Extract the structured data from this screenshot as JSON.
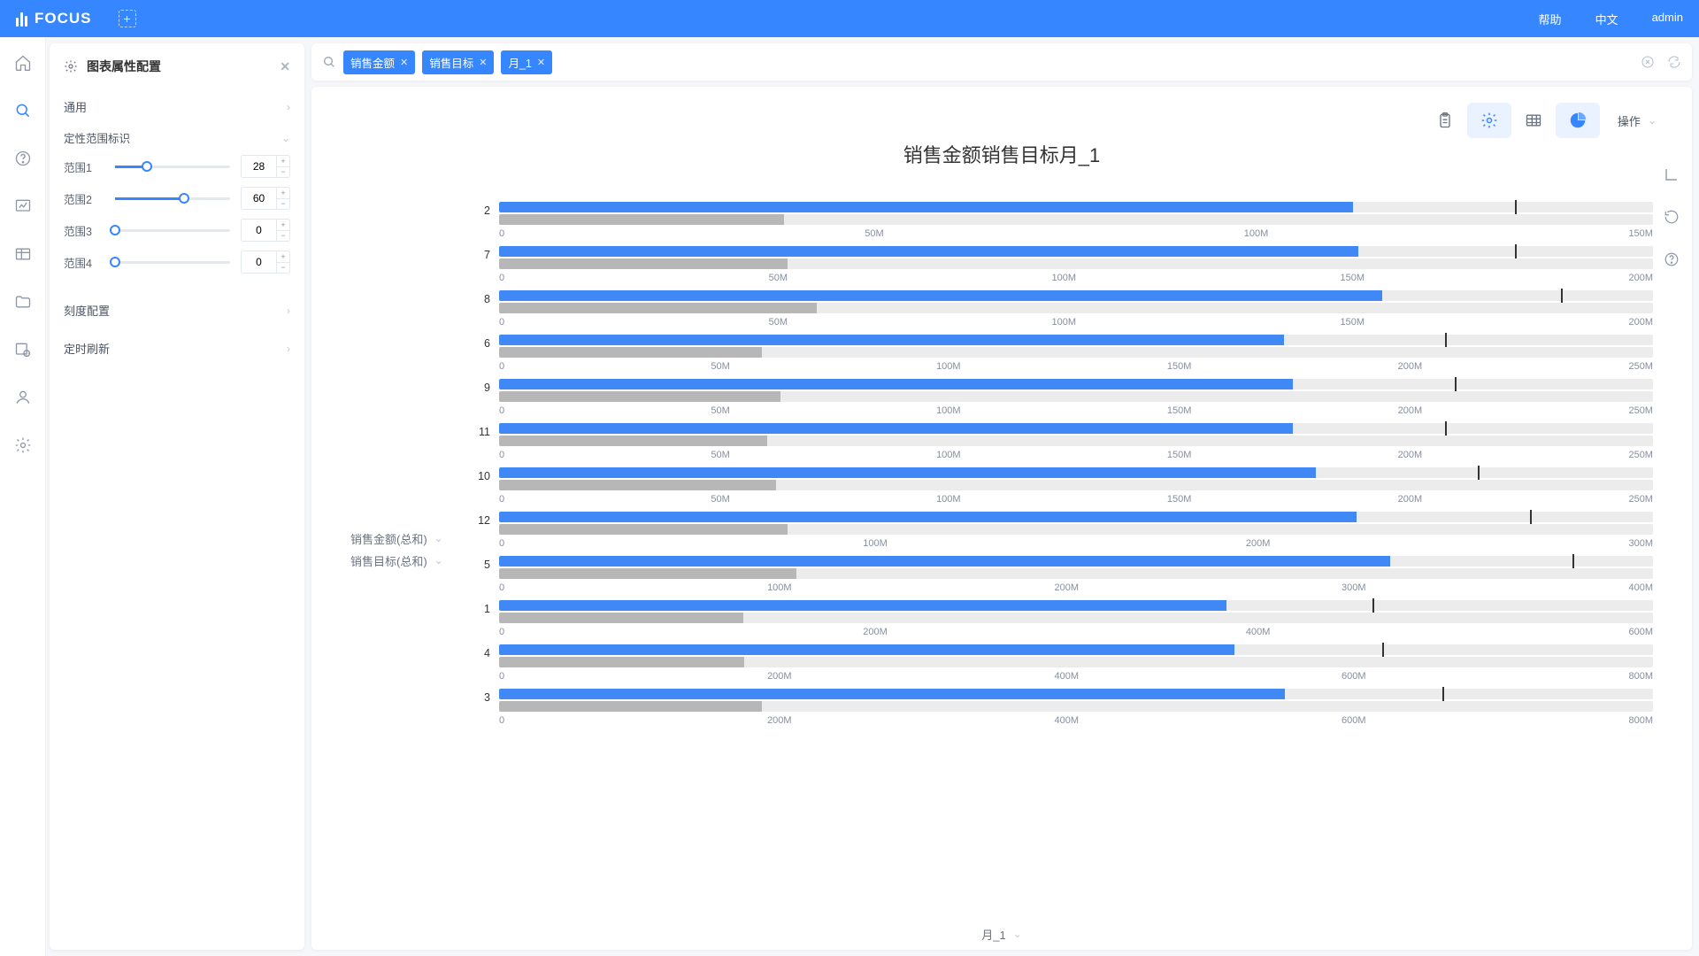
{
  "app": {
    "name": "FOCUS"
  },
  "topnav": {
    "help": "帮助",
    "lang": "中文",
    "user": "admin"
  },
  "config": {
    "title": "图表属性配置",
    "sections": {
      "general": "通用",
      "ranges": "定性范围标识",
      "scale": "刻度配置",
      "refresh": "定时刷新"
    },
    "range_labels": [
      "范围1",
      "范围2",
      "范围3",
      "范围4"
    ],
    "range_values": [
      28,
      60,
      0,
      0
    ]
  },
  "search": {
    "tags": [
      "销售金额",
      "销售目标",
      "月_1"
    ]
  },
  "toolbar": {
    "action": "操作"
  },
  "chart_title": "销售金额销售目标月_1",
  "legend": {
    "actual": "销售金额(总和)",
    "target": "销售目标(总和)"
  },
  "footer": {
    "dim": "月_1"
  },
  "chart_data": {
    "type": "bar",
    "subtype": "bullet",
    "xlabel": "月_1",
    "series_names": [
      "销售金额(总和)",
      "销售目标(总和)"
    ],
    "rows": [
      {
        "cat": "2",
        "actual": 111000000,
        "target": 37000000,
        "marker": 132000000,
        "max": 150000000,
        "ticks": [
          "0",
          "50M",
          "100M",
          "150M"
        ]
      },
      {
        "cat": "7",
        "actual": 149000000,
        "target": 50000000,
        "marker": 176000000,
        "max": 200000000,
        "ticks": [
          "0",
          "50M",
          "100M",
          "150M",
          "200M"
        ]
      },
      {
        "cat": "8",
        "actual": 153000000,
        "target": 55000000,
        "marker": 184000000,
        "max": 200000000,
        "ticks": [
          "0",
          "50M",
          "100M",
          "150M",
          "200M"
        ]
      },
      {
        "cat": "6",
        "actual": 170000000,
        "target": 57000000,
        "marker": 205000000,
        "max": 250000000,
        "ticks": [
          "0",
          "50M",
          "100M",
          "150M",
          "200M",
          "250M"
        ]
      },
      {
        "cat": "9",
        "actual": 172000000,
        "target": 61000000,
        "marker": 207000000,
        "max": 250000000,
        "ticks": [
          "0",
          "50M",
          "100M",
          "150M",
          "200M",
          "250M"
        ]
      },
      {
        "cat": "11",
        "actual": 172000000,
        "target": 58000000,
        "marker": 205000000,
        "max": 250000000,
        "ticks": [
          "0",
          "50M",
          "100M",
          "150M",
          "200M",
          "250M"
        ]
      },
      {
        "cat": "10",
        "actual": 177000000,
        "target": 60000000,
        "marker": 212000000,
        "max": 250000000,
        "ticks": [
          "0",
          "50M",
          "100M",
          "150M",
          "200M",
          "250M"
        ]
      },
      {
        "cat": "12",
        "actual": 223000000,
        "target": 75000000,
        "marker": 268000000,
        "max": 300000000,
        "ticks": [
          "0",
          "100M",
          "200M",
          "300M"
        ]
      },
      {
        "cat": "5",
        "actual": 309000000,
        "target": 103000000,
        "marker": 372000000,
        "max": 400000000,
        "ticks": [
          "0",
          "100M",
          "200M",
          "300M",
          "400M"
        ]
      },
      {
        "cat": "1",
        "actual": 378000000,
        "target": 127000000,
        "marker": 454000000,
        "max": 600000000,
        "ticks": [
          "0",
          "200M",
          "400M",
          "600M"
        ]
      },
      {
        "cat": "4",
        "actual": 510000000,
        "target": 170000000,
        "marker": 612000000,
        "max": 800000000,
        "ticks": [
          "0",
          "200M",
          "400M",
          "600M",
          "800M"
        ]
      },
      {
        "cat": "3",
        "actual": 545000000,
        "target": 182000000,
        "marker": 654000000,
        "max": 800000000,
        "ticks": [
          "0",
          "200M",
          "400M",
          "600M",
          "800M"
        ]
      }
    ]
  }
}
